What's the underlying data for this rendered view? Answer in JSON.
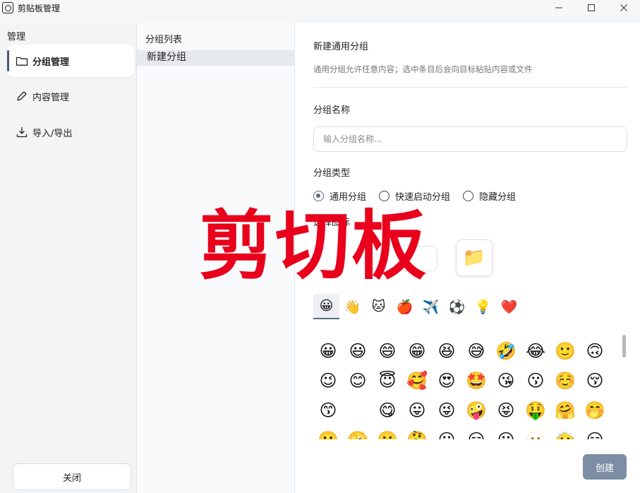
{
  "window": {
    "title": "剪贴板管理"
  },
  "nav": {
    "title": "管理",
    "items": [
      {
        "label": "分组管理",
        "icon": "folder-icon",
        "active": true
      },
      {
        "label": "内容管理",
        "icon": "pencil-icon",
        "active": false
      },
      {
        "label": "导入/导出",
        "icon": "download-icon",
        "active": false
      }
    ],
    "close_label": "关闭"
  },
  "groups": {
    "title": "分组列表",
    "items": [
      "新建分组"
    ]
  },
  "form": {
    "title": "新建通用分组",
    "description": "通用分组允许任意内容；选中条目后会向目标粘贴内容或文件",
    "name_label": "分组名称",
    "name_placeholder": "输入分组名称...",
    "type_label": "分组类型",
    "types": [
      {
        "label": "通用分组",
        "checked": true
      },
      {
        "label": "快速启动分组",
        "checked": false
      },
      {
        "label": "隐藏分组",
        "checked": false
      }
    ],
    "icon_label": "选择图标",
    "selected_icon": "📁",
    "emoji_tabs": [
      "😀",
      "👋",
      "🐱",
      "🍎",
      "✈️",
      "⚽",
      "💡",
      "❤️"
    ],
    "emojis": [
      "😀",
      "😃",
      "😄",
      "😁",
      "😆",
      "😅",
      "🤣",
      "😂",
      "🙂",
      "🙃",
      "😉",
      "😊",
      "😇",
      "🥰",
      "😍",
      "🤩",
      "😘",
      "😗",
      "☺️",
      "😚",
      "😙",
      "🫪",
      "😋",
      "😛",
      "😜",
      "🤪",
      "😝",
      "🤑",
      "🤗",
      "🤭",
      "🫢",
      "🫣",
      "🤫",
      "🤔",
      "😐",
      "😑",
      "😶",
      "🫥",
      "😶‍🌫️",
      "😏"
    ],
    "create_label": "创建"
  },
  "watermark": "剪切板",
  "colors": {
    "accent": "#5b6b80",
    "create_button": "#7c8da4",
    "watermark": "#e8001c"
  }
}
